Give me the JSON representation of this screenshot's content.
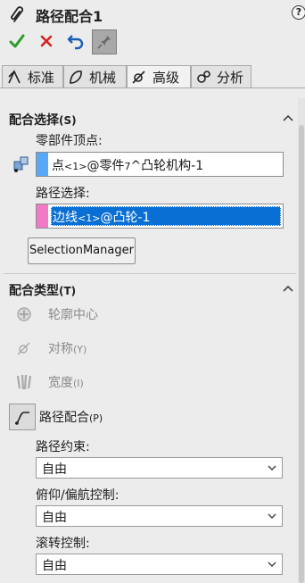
{
  "header": {
    "title": "路径配合1",
    "help_label": "?"
  },
  "toolbar": {
    "ok": "check-icon",
    "cancel": "x-icon",
    "undo": "undo-icon",
    "pin": "pushpin-icon"
  },
  "tabs": [
    {
      "label": "标准",
      "icon": "standard-mate-icon"
    },
    {
      "label": "机械",
      "icon": "mechanical-mate-icon"
    },
    {
      "label": "高级",
      "icon": "advanced-mate-icon",
      "active": true
    },
    {
      "label": "分析",
      "icon": "analysis-icon"
    }
  ],
  "mate_selection": {
    "heading": "配合选择",
    "heading_suffix": "(S)",
    "vertex_label": "零部件顶点:",
    "vertex_value_a": "点",
    "vertex_value_b": "<1>",
    "vertex_value_c": "@零件",
    "vertex_value_d": "7",
    "vertex_value_e": "^凸轮机构-1",
    "path_label": "路径选择:",
    "path_value_a": "边线",
    "path_value_b": "<1>",
    "path_value_c": "@凸轮-1",
    "selection_manager": "SelectionManager"
  },
  "mate_types": {
    "heading": "配合类型",
    "heading_suffix": "(T)",
    "items": [
      {
        "label": "轮廓中心",
        "suffix": "",
        "icon": "profile-center-icon",
        "enabled": false
      },
      {
        "label": "对称",
        "suffix": "(Y)",
        "icon": "symmetric-icon",
        "enabled": false
      },
      {
        "label": "宽度",
        "suffix": "(I)",
        "icon": "width-icon",
        "enabled": false
      },
      {
        "label": "路径配合",
        "suffix": "(P)",
        "icon": "path-mate-icon",
        "enabled": true,
        "selected": true
      }
    ]
  },
  "options": {
    "path_constraint_label": "路径约束:",
    "path_constraint_value": "自由",
    "pitch_yaw_label": "俯仰/偏航控制:",
    "pitch_yaw_value": "自由",
    "roll_label": "滚转控制:",
    "roll_value": "自由"
  },
  "colors": {
    "vertex_swatch": "#59a7f7",
    "path_swatch": "#f07ac6",
    "selected_highlight": "#0a6fd4",
    "ok_green": "#2f9a2b",
    "cancel_red": "#d42121"
  }
}
